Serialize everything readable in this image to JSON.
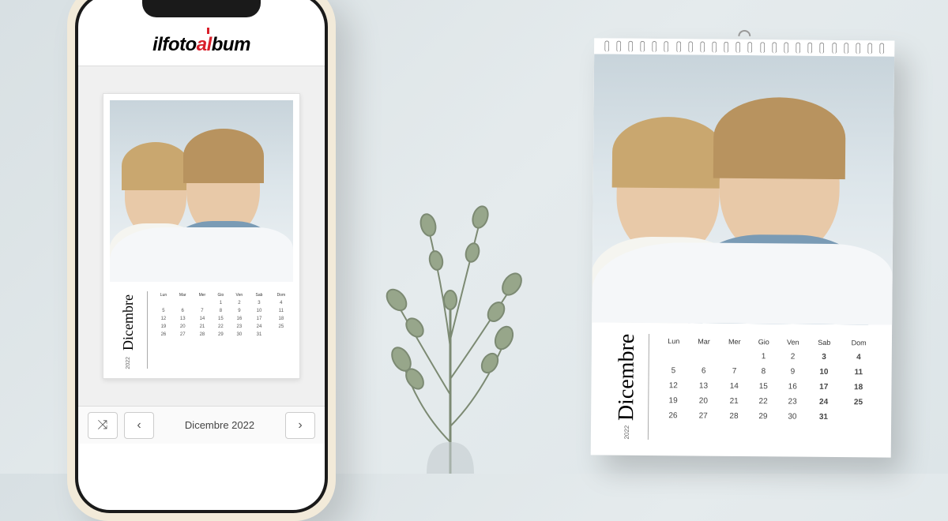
{
  "logo": {
    "part1": "ilfoto",
    "part2": "a",
    "part3": "l",
    "part4": "bum"
  },
  "toolbar": {
    "shuffle_icon": "⤨",
    "prev_icon": "‹",
    "next_icon": "›",
    "current_label": "Dicembre 2022"
  },
  "calendar": {
    "month": "Dicembre",
    "year": "2022",
    "headers_short": [
      "Lun",
      "Mar",
      "Mer",
      "Gio",
      "Ven",
      "Sab",
      "Dom"
    ],
    "weeks": [
      [
        "",
        "",
        "",
        "1",
        "2",
        "3",
        "4"
      ],
      [
        "5",
        "6",
        "7",
        "8",
        "9",
        "10",
        "11"
      ],
      [
        "12",
        "13",
        "14",
        "15",
        "16",
        "17",
        "18"
      ],
      [
        "19",
        "20",
        "21",
        "22",
        "23",
        "24",
        "25"
      ],
      [
        "26",
        "27",
        "28",
        "29",
        "30",
        "31",
        ""
      ]
    ]
  }
}
